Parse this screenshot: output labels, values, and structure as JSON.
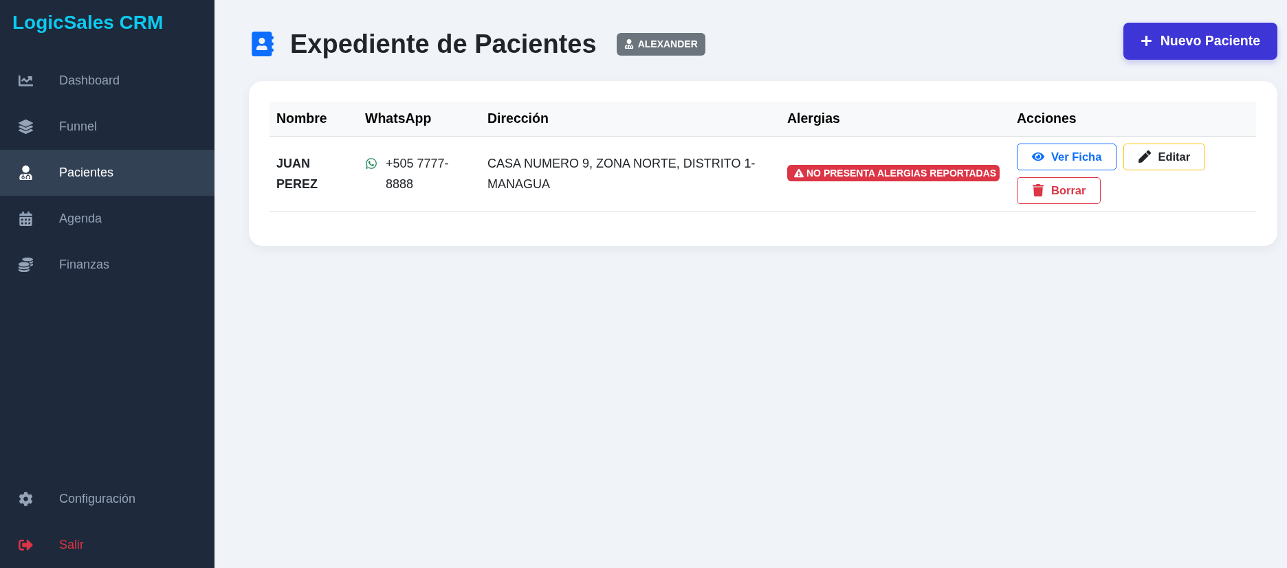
{
  "sidebar": {
    "logo": "LogicSales CRM",
    "items": [
      {
        "label": "Dashboard",
        "selected": false
      },
      {
        "label": "Funnel",
        "selected": false
      },
      {
        "label": "Pacientes",
        "selected": true
      },
      {
        "label": "Agenda",
        "selected": false
      },
      {
        "label": "Finanzas",
        "selected": false
      }
    ],
    "footer_items": [
      {
        "label": "Configuración",
        "kind": "settings"
      },
      {
        "label": "Salir",
        "kind": "logout"
      }
    ]
  },
  "header": {
    "title": "Expediente de Pacientes",
    "user_badge": "ALEXANDER",
    "new_button": "Nuevo Paciente"
  },
  "table": {
    "columns": [
      "Nombre",
      "WhatsApp",
      "Dirección",
      "Alergias",
      "Acciones"
    ],
    "rows": [
      {
        "name": "JUAN PEREZ",
        "whatsapp": "+505 7777-8888",
        "address": "CASA NUMERO 9, ZONA NORTE, DISTRITO 1-MANAGUA",
        "allergies": "NO PRESENTA ALERGIAS REPORTADAS",
        "actions": [
          {
            "label": "Ver Ficha",
            "kind": "view"
          },
          {
            "label": "Editar",
            "kind": "edit"
          },
          {
            "label": "Borrar",
            "kind": "delete"
          }
        ]
      }
    ]
  }
}
